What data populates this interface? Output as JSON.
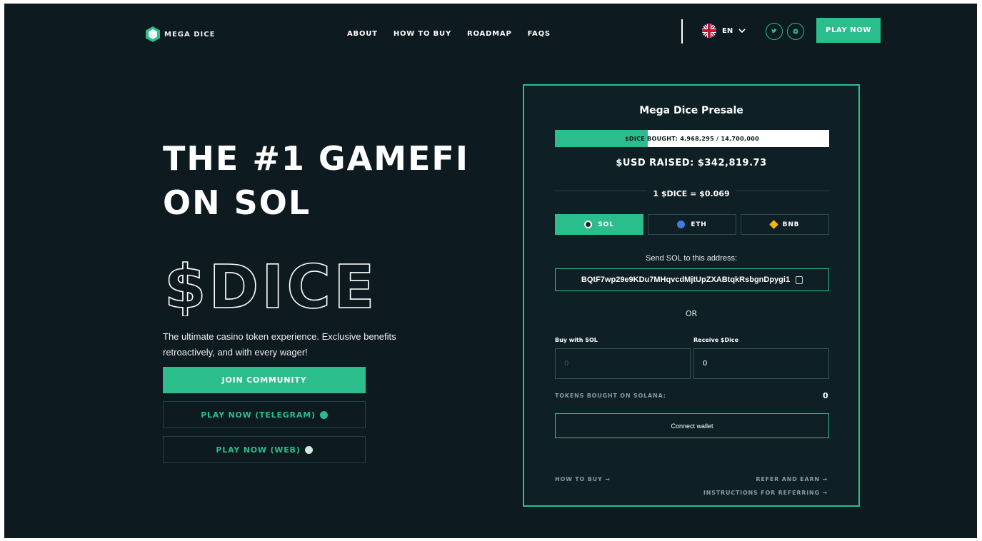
{
  "header": {
    "logo_text": "MEGA DICE",
    "nav": [
      "ABOUT",
      "HOW TO BUY",
      "ROADMAP",
      "FAQS"
    ],
    "language": "EN",
    "social_icons": [
      "twitter-icon",
      "telegram-icon"
    ],
    "cta_label": "PLAY NOW"
  },
  "hero": {
    "title_line1": "THE #1 GAMEFI",
    "title_line2": "ON SOL",
    "token_outline": "$DICE",
    "description": "The ultimate casino token experience. Exclusive benefits retroactively, and with every wager!",
    "join_label": "JOIN COMMUNITY",
    "telegram_label": "PLAY NOW (TELEGRAM)",
    "web_label": "PLAY NOW (WEB)"
  },
  "presale": {
    "title": "Mega Dice Presale",
    "progress_text": "$DICE BOUGHT: 4,968,295 / 14,700,000",
    "progress_fraction": 0.338,
    "raised": "$USD RAISED: $342,819.73",
    "rate": "1 $DICE = $0.069",
    "tabs": [
      {
        "label": "SOL",
        "icon": "solana-icon",
        "color": "#1e2a2e"
      },
      {
        "label": "ETH",
        "icon": "ethereum-icon",
        "color": "#3f7ae0"
      },
      {
        "label": "BNB",
        "icon": "bnb-icon",
        "color": "#f0b90b"
      }
    ],
    "send_label": "Send SOL to this address:",
    "address": "BQtF7wp29e9KDu7MHqvcdMjtUpZXABtqkRsbgnDpygi1",
    "or_label": "OR",
    "buy_label": "Buy with SOL",
    "buy_placeholder": "0",
    "receive_label": "Receive $Dice",
    "receive_value": "0",
    "tokens_bought_label": "TOKENS BOUGHT ON SOLANA:",
    "tokens_bought_value": "0",
    "connect_label": "Connect wallet",
    "how_to_buy": "HOW TO BUY →",
    "refer": "REFER AND EARN →",
    "instructions": "INSTRUCTIONS FOR REFERRING →"
  },
  "colors": {
    "accent": "#2bbd8c",
    "background": "#0d1a1f"
  }
}
